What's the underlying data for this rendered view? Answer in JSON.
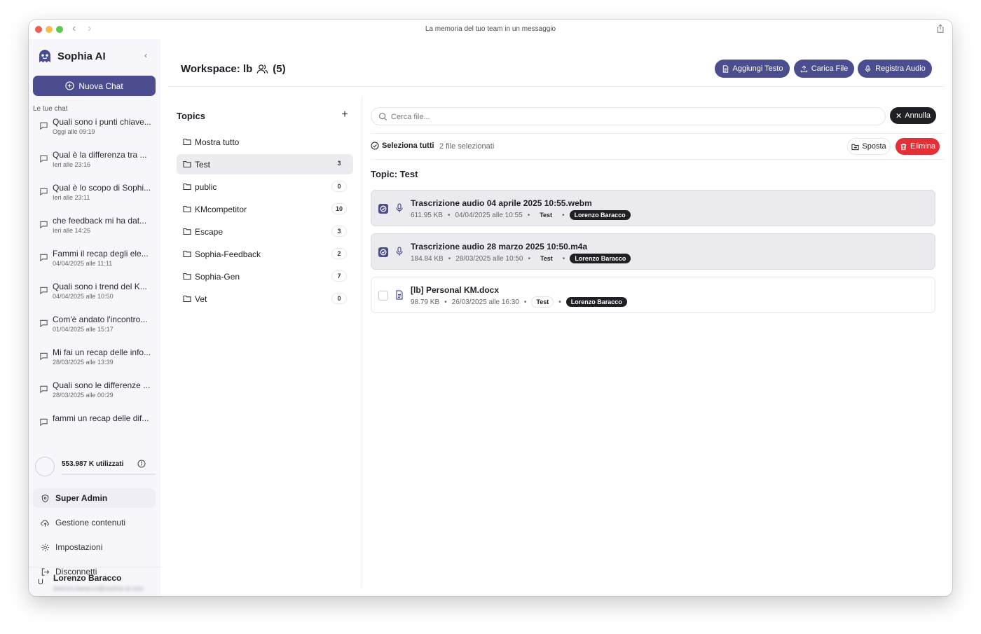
{
  "window": {
    "title": "La memoria del tuo team in un messaggio"
  },
  "brand": {
    "name": "Sophia AI"
  },
  "sidebar": {
    "new_chat_label": "Nuova Chat",
    "chats_label": "Le tue chat",
    "chats": [
      {
        "title": "Quali sono i punti chiave...",
        "time": "Oggi alle 09:19"
      },
      {
        "title": "Qual è la differenza tra ...",
        "time": "Ieri alle 23:16"
      },
      {
        "title": "Qual è lo scopo di Sophi...",
        "time": "Ieri alle 23:11"
      },
      {
        "title": "che feedback mi ha dat...",
        "time": "Ieri alle 14:26"
      },
      {
        "title": "Fammi il recap degli ele...",
        "time": "04/04/2025 alle 11:11"
      },
      {
        "title": "Quali sono i trend del K...",
        "time": "04/04/2025 alle 10:50"
      },
      {
        "title": "Com'è andato l'incontro...",
        "time": "01/04/2025 alle 15:17"
      },
      {
        "title": "Mi fai un recap delle info...",
        "time": "28/03/2025 alle 13:39"
      },
      {
        "title": "Quali sono le differenze ...",
        "time": "28/03/2025 alle 00:29"
      },
      {
        "title": "fammi un recap delle dif...",
        "time": ""
      }
    ],
    "usage": {
      "text": "553.987 K utilizzati"
    },
    "menu": {
      "super_admin": "Super Admin",
      "content": "Gestione contenuti",
      "settings": "Impostazioni",
      "logout": "Disconnetti"
    },
    "user": {
      "initial": "U",
      "name": "Lorenzo Baracco",
      "email": "lorenzo.baracco@sophia-ai.com"
    }
  },
  "header": {
    "workspace_title": "Workspace: lb",
    "member_count": "(5)",
    "add_text_label": "Aggiungi Testo",
    "upload_label": "Carica File",
    "record_label": "Registra Audio"
  },
  "topics": {
    "title": "Topics",
    "items": [
      {
        "name": "Mostra tutto",
        "count": null
      },
      {
        "name": "Test",
        "count": "3"
      },
      {
        "name": "public",
        "count": "0"
      },
      {
        "name": "KMcompetitor",
        "count": "10"
      },
      {
        "name": "Escape",
        "count": "3"
      },
      {
        "name": "Sophia-Feedback",
        "count": "2"
      },
      {
        "name": "Sophia-Gen",
        "count": "7"
      },
      {
        "name": "Vet",
        "count": "0"
      }
    ]
  },
  "files": {
    "search_placeholder": "Cerca file...",
    "cancel_label": "Annulla",
    "select_all_label": "Seleziona tutti",
    "selected_count": "2 file selezionati",
    "move_label": "Sposta",
    "delete_label": "Elimina",
    "topic_heading": "Topic: Test",
    "items": [
      {
        "name": "Trascrizione audio 04 aprile 2025 10:55.webm",
        "size": "611.95 KB",
        "date": "04/04/2025 alle 10:55",
        "topic": "Test",
        "owner": "Lorenzo Baracco"
      },
      {
        "name": "Trascrizione audio 28 marzo 2025 10:50.m4a",
        "size": "184.84 KB",
        "date": "28/03/2025 alle 10:50",
        "topic": "Test",
        "owner": "Lorenzo Baracco"
      },
      {
        "name": "[lb] Personal KM.docx",
        "size": "98.79 KB",
        "date": "26/03/2025 alle 16:30",
        "topic": "Test",
        "owner": "Lorenzo Baracco"
      }
    ]
  },
  "colors": {
    "accent": "#4c4d8f",
    "danger": "#e32f35",
    "dark": "#1f1f24"
  }
}
